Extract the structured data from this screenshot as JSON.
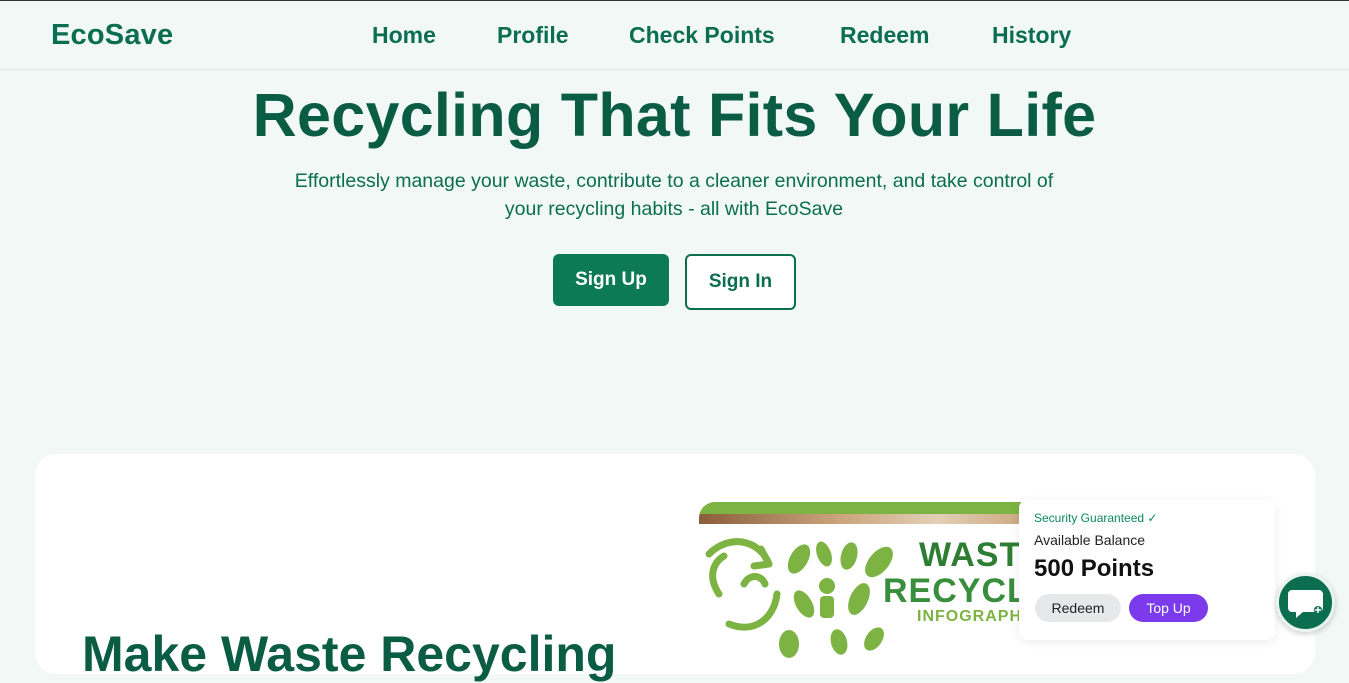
{
  "header": {
    "logo": "EcoSave",
    "nav": [
      "Home",
      "Profile",
      "Check Points",
      "Redeem",
      "History"
    ]
  },
  "hero": {
    "title": "Recycling That Fits Your Life",
    "subtitle": "Effortlessly manage your waste, contribute to a cleaner environment, and take control of your recycling habits - all with EcoSave",
    "signup_label": "Sign Up",
    "signin_label": "Sign In"
  },
  "feature": {
    "heading": "Make Waste Recycling",
    "infographic": {
      "line1": "WASTE",
      "line2": "RECYCLI",
      "line3": "INFOGRAPHI"
    },
    "balance_card": {
      "security": "Security Guaranteed ✓",
      "label": "Available Balance",
      "points": "500 Points",
      "redeem_label": "Redeem",
      "topup_label": "Top Up"
    }
  },
  "chat": {
    "icon": "chat-bubble-icon"
  },
  "colors": {
    "brand": "#0b6e4f",
    "background": "#f1f8f5",
    "topup": "#7c3aed"
  }
}
